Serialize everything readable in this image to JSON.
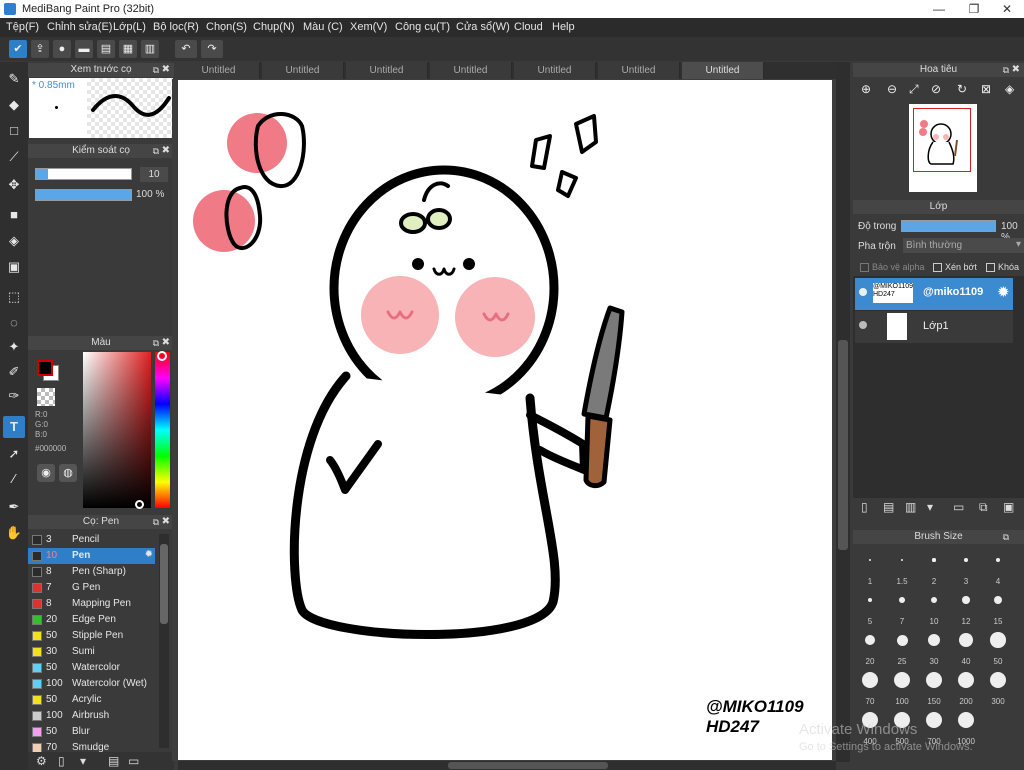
{
  "window": {
    "title": "MediBang Paint Pro (32bit)",
    "min": "—",
    "max": "❐",
    "close": "✕"
  },
  "menu": [
    "Tệp(F)",
    "Chỉnh sửa(E)",
    "Lớp(L)",
    "Bộ lọc(R)",
    "Chọn(S)",
    "Chụp(N)",
    "Màu (C)",
    "Xem(V)",
    "Công cụ(T)",
    "Cửa sổ(W)",
    "Cloud",
    "Help"
  ],
  "tabs": [
    "Untitled",
    "Untitled",
    "Untitled",
    "Untitled",
    "Untitled",
    "Untitled",
    "Untitled"
  ],
  "preview": {
    "title": "Xem trước cọ",
    "size": "* 0.85mm"
  },
  "brush_control": {
    "title": "Kiểm soát cọ",
    "size": "10",
    "opacity": "100 %",
    "size_fraction": 0.13,
    "opacity_fraction": 1.0
  },
  "color": {
    "title": "Màu",
    "r": "R:0",
    "g": "G:0",
    "b": "B:0",
    "hex": "#000000"
  },
  "brushes": {
    "title": "Cọ: Pen",
    "items": [
      {
        "n": "3",
        "label": "Pencil",
        "color": "#2b2b2b"
      },
      {
        "n": "10",
        "label": "Pen",
        "color": "#2b2b2b",
        "selected": true
      },
      {
        "n": "8",
        "label": "Pen (Sharp)",
        "color": "#2b2b2b"
      },
      {
        "n": "7",
        "label": "G Pen",
        "color": "#e03030"
      },
      {
        "n": "8",
        "label": "Mapping Pen",
        "color": "#e03030"
      },
      {
        "n": "20",
        "label": "Edge Pen",
        "color": "#30c030"
      },
      {
        "n": "50",
        "label": "Stipple Pen",
        "color": "#f0e020"
      },
      {
        "n": "30",
        "label": "Sumi",
        "color": "#f0e020"
      },
      {
        "n": "50",
        "label": "Watercolor",
        "color": "#60d0f0"
      },
      {
        "n": "100",
        "label": "Watercolor (Wet)",
        "color": "#60d0f0"
      },
      {
        "n": "50",
        "label": "Acrylic",
        "color": "#f0e020"
      },
      {
        "n": "100",
        "label": "Airbrush",
        "color": "#cccccc"
      },
      {
        "n": "50",
        "label": "Blur",
        "color": "#f0a0f0"
      },
      {
        "n": "70",
        "label": "Smudge",
        "color": "#f0d0b0"
      }
    ]
  },
  "navigator": {
    "title": "Hoa tiêu"
  },
  "layer": {
    "title": "Lớp",
    "opacity_label": "Độ trong",
    "opacity": "100 %",
    "blend_label": "Pha trộn",
    "blend": "Bình thường",
    "protect_alpha": "Bảo vệ alpha",
    "clip": "Xén bớt",
    "lock": "Khóa",
    "layers": [
      {
        "name": "@miko1109",
        "selected": true
      },
      {
        "name": "Lớp1",
        "selected": false
      }
    ]
  },
  "brush_size": {
    "title": "Brush Size",
    "sizes": [
      "1",
      "1.5",
      "2",
      "3",
      "4",
      "5",
      "7",
      "10",
      "12",
      "15",
      "20",
      "25",
      "30",
      "40",
      "50",
      "70",
      "100",
      "150",
      "200",
      "300",
      "400",
      "500",
      "700",
      "1000"
    ]
  },
  "signature": {
    "line1": "@MIKO1109",
    "line2": "HD247"
  },
  "watermark": {
    "line1": "Activate Windows",
    "line2": "Go to Settings to activate Windows."
  }
}
